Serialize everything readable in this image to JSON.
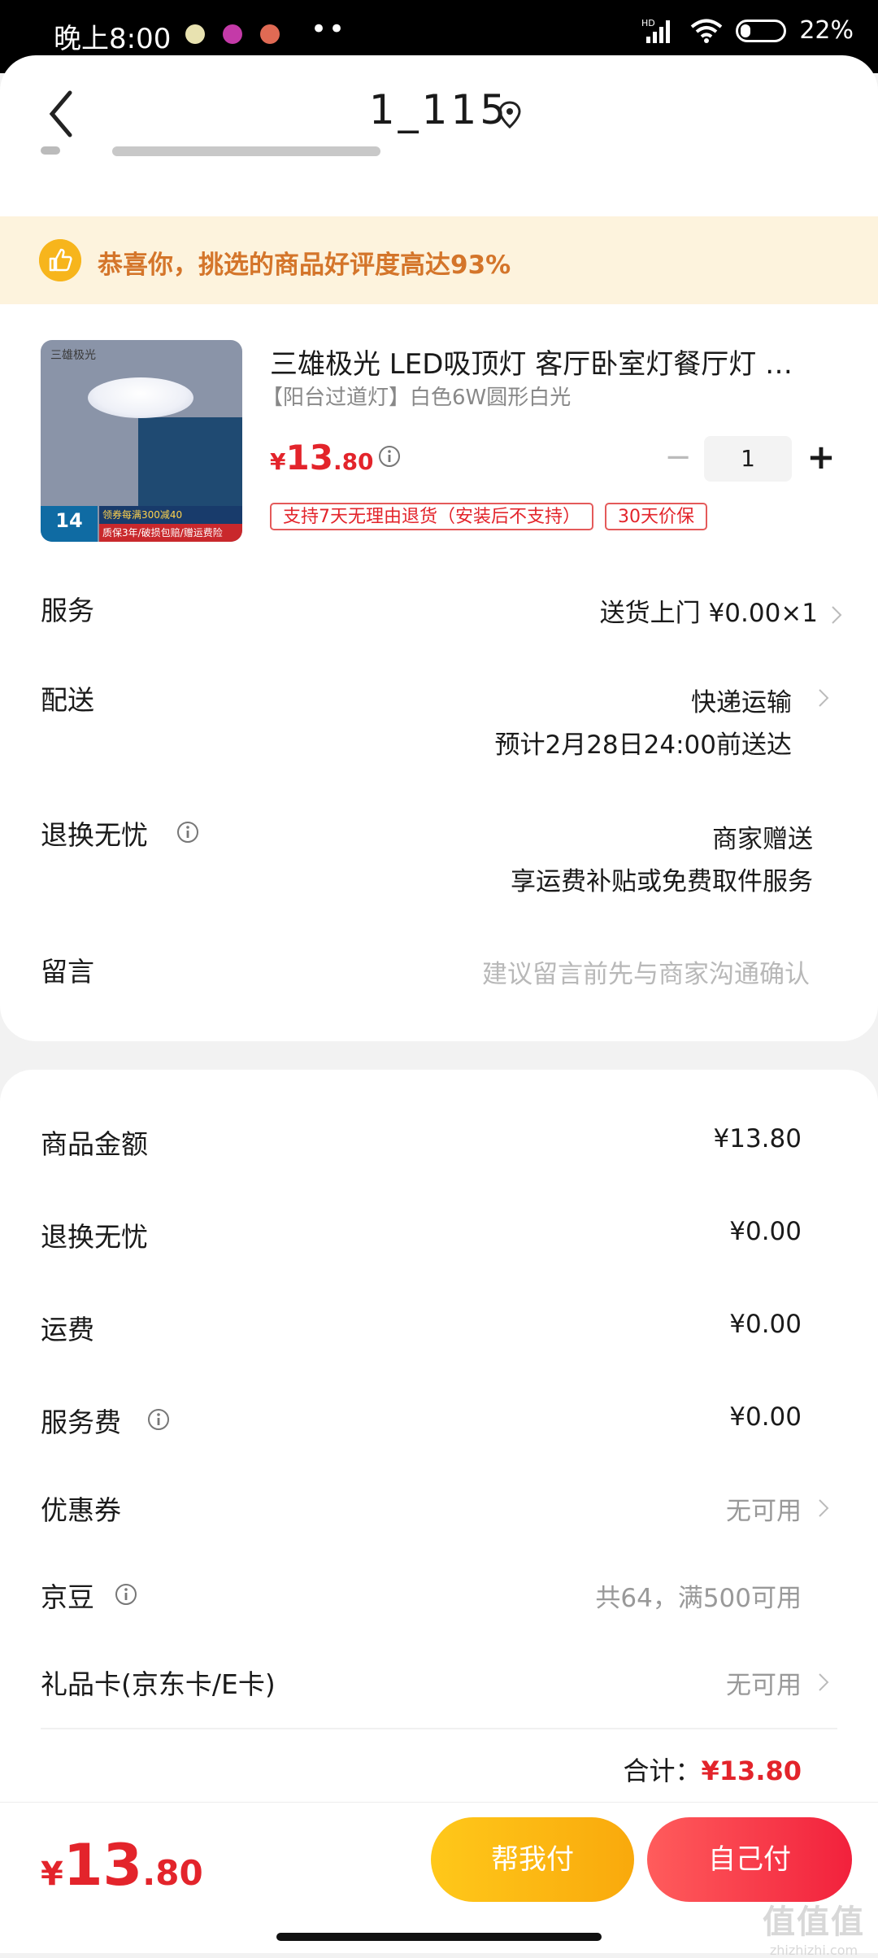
{
  "status_bar": {
    "time": "晚上8:00",
    "network": "HD",
    "battery": "22%"
  },
  "nav": {
    "title": "1_115"
  },
  "banner": {
    "text": "恭喜你，挑选的商品好评度高达93%"
  },
  "product": {
    "title": "三雄极光 LED吸顶灯 客厅卧室灯餐厅灯 …",
    "spec": "【阳台过道灯】白色6W圆形白光",
    "price_symbol": "¥",
    "price_int": "13",
    "price_dec": ".80",
    "quantity": "1",
    "minus": "−",
    "plus": "+",
    "tags": [
      "支持7天无理由退货（安装后不支持）",
      "30天价保"
    ],
    "image_badge": "14",
    "image_promo1": "领券每满300减40",
    "image_promo2": "质保3年/破损包赔/赠运费险"
  },
  "rows": {
    "service": {
      "label": "服务",
      "value": "送货上门 ¥0.00×1"
    },
    "delivery": {
      "label": "配送",
      "value": "快递运输",
      "sub": "预计2月28日24:00前送达"
    },
    "return": {
      "label": "退换无忧",
      "value": "商家赠送",
      "sub": "享运费补贴或免费取件服务"
    },
    "message": {
      "label": "留言",
      "placeholder": "建议留言前先与商家沟通确认"
    }
  },
  "summary": [
    {
      "label": "商品金额",
      "value": "¥13.80"
    },
    {
      "label": "退换无忧",
      "value": "¥0.00"
    },
    {
      "label": "运费",
      "value": "¥0.00"
    },
    {
      "label": "服务费",
      "value": "¥0.00"
    },
    {
      "label": "优惠券",
      "value": "无可用"
    },
    {
      "label": "京豆",
      "value": "共64，满500可用"
    },
    {
      "label": "礼品卡(京东卡/E卡)",
      "value": "无可用"
    }
  ],
  "total": {
    "label": "合计：",
    "amount": "¥13.80"
  },
  "bottom_bar": {
    "price_symbol": "¥",
    "price_int": "13",
    "price_dec": ".80",
    "help_pay": "帮我付",
    "self_pay": "自己付"
  },
  "watermark": {
    "main": "值值值",
    "sub": "zhizhizhi.com"
  },
  "colors": {
    "accent_red": "#e3242b",
    "banner_text": "#d4752a",
    "help_button": "#ffc81a",
    "self_button": "#f2213c"
  }
}
